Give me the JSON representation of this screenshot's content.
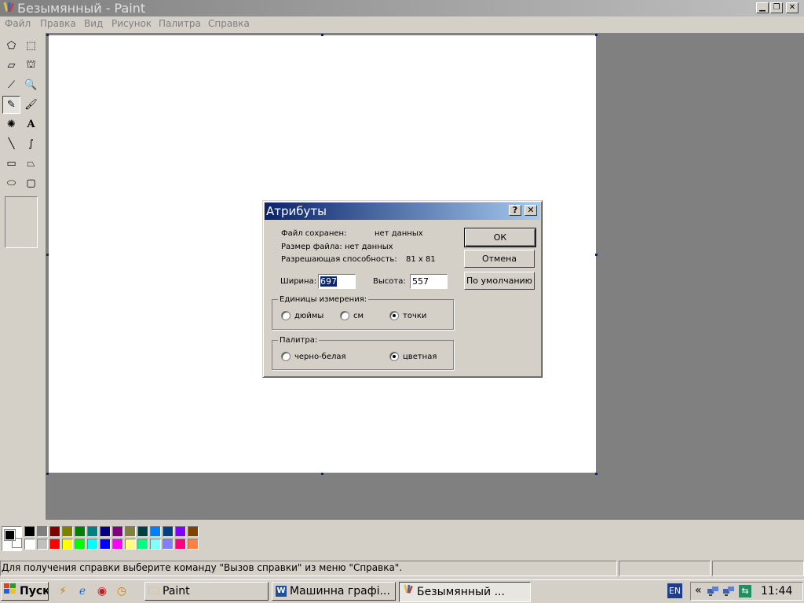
{
  "window": {
    "title": "Безымянный - Paint",
    "menu": [
      "Файл",
      "Правка",
      "Вид",
      "Рисунок",
      "Палитра",
      "Справка"
    ]
  },
  "toolbox": {
    "tools": [
      {
        "name": "free-select-icon",
        "glyph": "⬠"
      },
      {
        "name": "select-icon",
        "glyph": "⬚"
      },
      {
        "name": "eraser-icon",
        "glyph": "▱"
      },
      {
        "name": "fill-icon",
        "glyph": "⛫"
      },
      {
        "name": "color-picker-icon",
        "glyph": "⟋"
      },
      {
        "name": "magnifier-icon",
        "glyph": "🔍"
      },
      {
        "name": "pencil-icon",
        "glyph": "✎"
      },
      {
        "name": "brush-icon",
        "glyph": "🖌"
      },
      {
        "name": "airbrush-icon",
        "glyph": "✺"
      },
      {
        "name": "text-icon",
        "glyph": "A"
      },
      {
        "name": "line-icon",
        "glyph": "╲"
      },
      {
        "name": "curve-icon",
        "glyph": "∫"
      },
      {
        "name": "rectangle-icon",
        "glyph": "▭"
      },
      {
        "name": "polygon-icon",
        "glyph": "⏢"
      },
      {
        "name": "ellipse-icon",
        "glyph": "⬭"
      },
      {
        "name": "rounded-rect-icon",
        "glyph": "▢"
      }
    ],
    "selected_tool": "pencil-icon"
  },
  "palette": {
    "foreground": "#000000",
    "background": "#ffffff",
    "row1": [
      "#000000",
      "#808080",
      "#800000",
      "#808000",
      "#008000",
      "#008080",
      "#000080",
      "#800080",
      "#808040",
      "#004040",
      "#0080ff",
      "#004080",
      "#8000ff",
      "#804000"
    ],
    "row2": [
      "#ffffff",
      "#c0c0c0",
      "#ff0000",
      "#ffff00",
      "#00ff00",
      "#00ffff",
      "#0000ff",
      "#ff00ff",
      "#ffff80",
      "#00ff80",
      "#80ffff",
      "#8080ff",
      "#ff0080",
      "#ff8040"
    ]
  },
  "statusbar": {
    "text": "Для получения справки выберите команду \"Вызов справки\" из меню \"Справка\"."
  },
  "dialog": {
    "title": "Атрибуты",
    "help_glyph": "?",
    "close_glyph": "✕",
    "file_saved_label": "Файл сохранен:",
    "file_saved_value": "нет данных",
    "file_size_label": "Размер файла: нет данных",
    "resolution_label": "Разрешающая способность:",
    "resolution_value": "81 x 81",
    "width_label": "Ширина:",
    "width_value": "697",
    "height_label": "Высота:",
    "height_value": "557",
    "units_group": "Единицы измерения:",
    "units_options": [
      "дюймы",
      "см",
      "точки"
    ],
    "units_selected": "точки",
    "palette_group": "Палитра:",
    "palette_options": [
      "черно-белая",
      "цветная"
    ],
    "palette_selected": "цветная",
    "ok_label": "ОК",
    "cancel_label": "Отмена",
    "default_label": "По умолчанию"
  },
  "taskbar": {
    "start_label": "Пуск",
    "tasks": [
      {
        "label": "Paint",
        "icon": "folder-icon",
        "active": false
      },
      {
        "label": "Машинна графі...",
        "icon": "word-icon",
        "active": false
      },
      {
        "label": "Безымянный ...",
        "icon": "paint-icon",
        "active": true
      }
    ],
    "language": "EN",
    "tray_chevron": "«",
    "clock": "11:44"
  }
}
